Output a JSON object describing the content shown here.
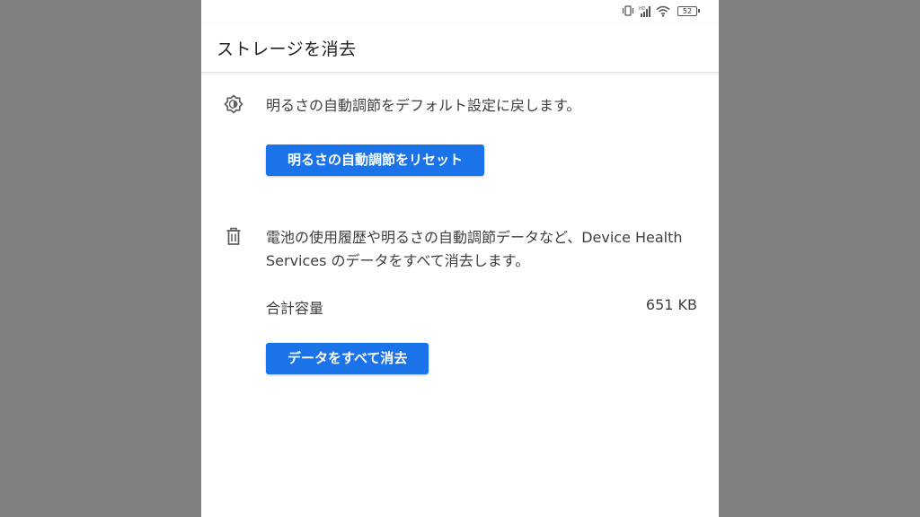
{
  "status_bar": {
    "battery_level": "52",
    "icons": [
      "vibrate-icon",
      "signal-icon",
      "wifi-icon",
      "battery-icon"
    ]
  },
  "app_bar": {
    "title": "ストレージを消去"
  },
  "brightness_section": {
    "icon": "adaptive-brightness-icon",
    "description": "明るさの自動調節をデフォルト設定に戻します。",
    "button_label": "明るさの自動調節をリセット"
  },
  "data_section": {
    "icon": "trash-icon",
    "description": "電池の使用履歴や明るさの自動調節データなど、Device Health Services のデータをすべて消去します。",
    "total_label": "合計容量",
    "total_value": "651 KB",
    "button_label": "データをすべて消去"
  },
  "colors": {
    "accent": "#1a73e8",
    "background": "#808080",
    "surface": "#ffffff"
  }
}
